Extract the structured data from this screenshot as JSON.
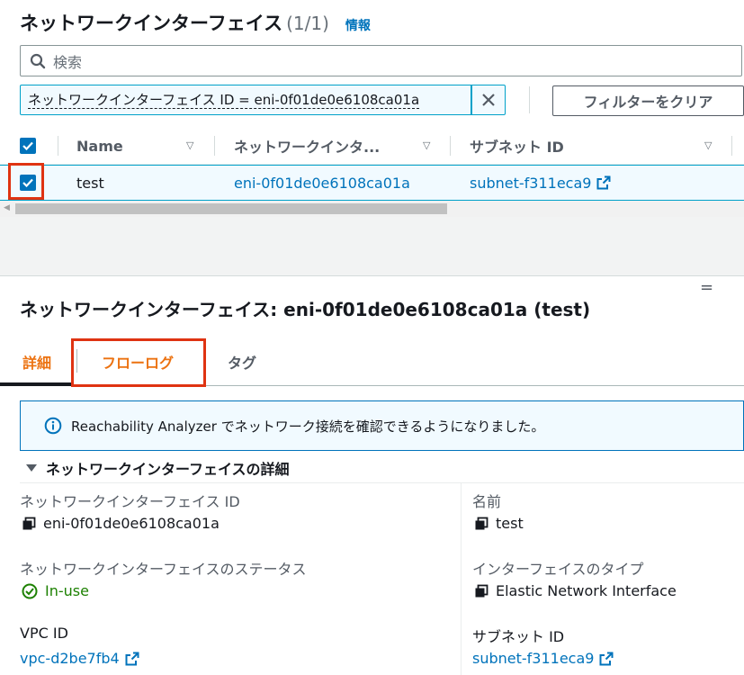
{
  "header": {
    "title": "ネットワークインターフェイス",
    "count": "(1/1)",
    "info_link": "情報"
  },
  "search": {
    "placeholder": "検索"
  },
  "filter": {
    "token": "ネットワークインターフェイス ID = eni-0f01de0e6108ca01a",
    "clear_button": "フィルターをクリア"
  },
  "table": {
    "columns": [
      "Name",
      "ネットワークインタ...",
      "サブネット ID"
    ],
    "rows": [
      {
        "name": "test",
        "eni_id": "eni-0f01de0e6108ca01a",
        "subnet_id": "subnet-f311eca9",
        "selected": true
      }
    ]
  },
  "detail": {
    "title": "ネットワークインターフェイス: eni-0f01de0e6108ca01a (test)",
    "tabs": [
      {
        "label": "詳細",
        "active": true
      },
      {
        "label": "フローログ",
        "active": false,
        "highlighted": true
      },
      {
        "label": "タグ",
        "active": false
      }
    ],
    "alert": "Reachability Analyzer でネットワーク接続を確認できるようになりました。",
    "section_title": "ネットワークインターフェイスの詳細",
    "fields": {
      "eni_id_label": "ネットワークインターフェイス ID",
      "eni_id_value": "eni-0f01de0e6108ca01a",
      "name_label": "名前",
      "name_value": "test",
      "status_label": "ネットワークインターフェイスのステータス",
      "status_value": "In-use",
      "type_label": "インターフェイスのタイプ",
      "type_value": "Elastic Network Interface",
      "vpc_label": "VPC ID",
      "vpc_value": "vpc-d2be7fb4",
      "subnet_label": "サブネット ID",
      "subnet_value": "subnet-f311eca9"
    }
  },
  "colors": {
    "link": "#0073bb",
    "active_tab": "#ec7211",
    "highlight": "#df3312",
    "success": "#1d8102"
  },
  "icons": [
    "search-icon",
    "close-icon",
    "checkbox-checked-icon",
    "caret-down-icon",
    "external-link-icon",
    "info-icon",
    "copy-icon",
    "status-ok-icon",
    "triangle-down-icon"
  ]
}
